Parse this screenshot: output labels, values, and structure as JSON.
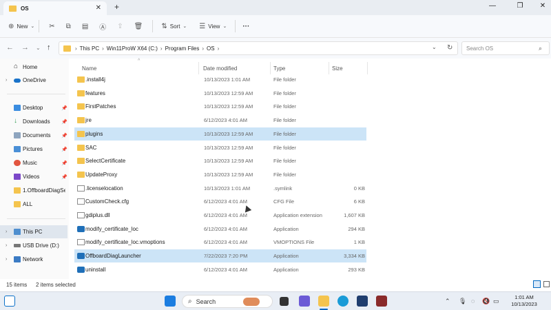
{
  "window": {
    "tab_title": "OS",
    "close_tab": "✕",
    "new_tab": "+",
    "minimize": "—",
    "maximize": "❐",
    "close": "✕"
  },
  "toolbar": {
    "new_label": "New",
    "sort_label": "Sort",
    "view_label": "View",
    "more": "···"
  },
  "address": {
    "crumbs": [
      "This PC",
      "Win11ProW X64 (C:)",
      "Program Files",
      "OS"
    ],
    "search_placeholder": "Search OS"
  },
  "sidebar": {
    "items": [
      {
        "label": "Home"
      },
      {
        "label": "OneDrive"
      },
      {
        "label": "Desktop"
      },
      {
        "label": "Downloads"
      },
      {
        "label": "Documents"
      },
      {
        "label": "Pictures"
      },
      {
        "label": "Music"
      },
      {
        "label": "Videos"
      },
      {
        "label": "1.OffboardDiagSetu"
      },
      {
        "label": "ALL"
      },
      {
        "label": "This PC"
      },
      {
        "label": "USB Drive (D:)"
      },
      {
        "label": "Network"
      }
    ]
  },
  "columns": {
    "name": "Name",
    "date": "Date modified",
    "type": "Type",
    "size": "Size"
  },
  "files": [
    {
      "name": ".install4j",
      "date": "10/13/2023 1:01 AM",
      "type": "File folder",
      "size": "",
      "icon": "folder-icon"
    },
    {
      "name": "features",
      "date": "10/13/2023 12:59 AM",
      "type": "File folder",
      "size": "",
      "icon": "folder-icon"
    },
    {
      "name": "FirstPatches",
      "date": "10/13/2023 12:59 AM",
      "type": "File folder",
      "size": "",
      "icon": "folder-icon"
    },
    {
      "name": "jre",
      "date": "6/12/2023 4:01 AM",
      "type": "File folder",
      "size": "",
      "icon": "folder-icon"
    },
    {
      "name": "plugins",
      "date": "10/13/2023 12:59 AM",
      "type": "File folder",
      "size": "",
      "icon": "folder-icon"
    },
    {
      "name": "SAC",
      "date": "10/13/2023 12:59 AM",
      "type": "File folder",
      "size": "",
      "icon": "folder-icon"
    },
    {
      "name": "SelectCertificate",
      "date": "10/13/2023 12:59 AM",
      "type": "File folder",
      "size": "",
      "icon": "folder-icon"
    },
    {
      "name": "UpdateProxy",
      "date": "10/13/2023 12:59 AM",
      "type": "File folder",
      "size": "",
      "icon": "folder-icon"
    },
    {
      "name": ".licenselocation",
      "date": "10/13/2023 1:01 AM",
      "type": ".symlink",
      "size": "0 KB",
      "icon": "file-icon"
    },
    {
      "name": "CustomCheck.cfg",
      "date": "6/12/2023 4:01 AM",
      "type": "CFG File",
      "size": "6 KB",
      "icon": "file-icon"
    },
    {
      "name": "gdiplus.dll",
      "date": "6/12/2023 4:01 AM",
      "type": "Application extension",
      "size": "1,607 KB",
      "icon": "dll-icon"
    },
    {
      "name": "modify_certificate_loc",
      "date": "6/12/2023 4:01 AM",
      "type": "Application",
      "size": "294 KB",
      "icon": "app-icon"
    },
    {
      "name": "modify_certificate_loc.vmoptions",
      "date": "6/12/2023 4:01 AM",
      "type": "VMOPTIONS File",
      "size": "1 KB",
      "icon": "file-icon"
    },
    {
      "name": "OffboardDiagLauncher",
      "date": "7/22/2023 7:20 PM",
      "type": "Application",
      "size": "3,334 KB",
      "icon": "app-icon"
    },
    {
      "name": "uninstall",
      "date": "6/12/2023 4:01 AM",
      "type": "Application",
      "size": "293 KB",
      "icon": "app-icon"
    }
  ],
  "status": {
    "item_count": "15 items",
    "selected_count": "2 items selected"
  },
  "taskbar": {
    "search_label": "Search",
    "time": "1:01 AM",
    "date": "10/13/2023"
  },
  "colors": {
    "selection": "#cce4f7",
    "folder": "#f4c44e",
    "accent": "#0067c0"
  }
}
